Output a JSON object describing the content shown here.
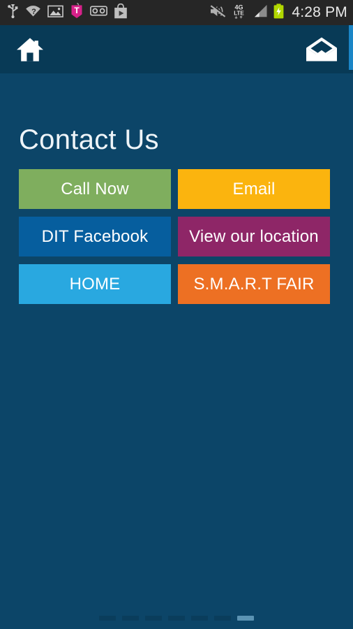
{
  "status_bar": {
    "background": "#262626",
    "time": "4:28 PM",
    "left_icons": [
      {
        "name": "usb-icon",
        "label": "USB"
      },
      {
        "name": "wifi-question-icon",
        "label": "Wi-Fi needs sign in"
      },
      {
        "name": "screenshot-image-icon",
        "label": "Screenshot saved"
      },
      {
        "name": "t-mobile-icon",
        "label": "T-Mobile"
      },
      {
        "name": "voicemail-icon",
        "label": "Voicemail"
      },
      {
        "name": "play-store-icon",
        "label": "Play Store"
      }
    ],
    "right_icons": [
      {
        "name": "mute-icon",
        "label": "Sound off"
      },
      {
        "name": "network-4g-lte-icon",
        "label": "4G LTE"
      },
      {
        "name": "signal-bars-icon",
        "label": "Signal"
      },
      {
        "name": "battery-charging-icon",
        "label": "Charging"
      }
    ],
    "network_label_top": "4G",
    "network_label_bottom": "LTE"
  },
  "header": {
    "background": "#083a56",
    "home_icon": "home-icon",
    "mail_icon": "open-envelope-icon",
    "edge_strip_color": "#1a85c6"
  },
  "page": {
    "background": "#0c4568",
    "title": "Contact Us"
  },
  "tiles": [
    {
      "label": "Call Now",
      "color": "#7fae5e",
      "name": "tile-call-now"
    },
    {
      "label": "Email",
      "color": "#fbb40e",
      "name": "tile-email"
    },
    {
      "label": "DIT Facebook",
      "color": "#065e9e",
      "name": "tile-dit-facebook"
    },
    {
      "label": "View our location",
      "color": "#8e2667",
      "name": "tile-view-our-location"
    },
    {
      "label": "HOME",
      "color": "#29a8e0",
      "name": "tile-home"
    },
    {
      "label": "S.M.A.R.T FAIR",
      "color": "#ed7023",
      "name": "tile-smart-fair"
    }
  ],
  "page_indicator": {
    "total": 7,
    "active_index": 6,
    "inactive_color": "#0a3d5c",
    "active_color": "#5b93b3"
  }
}
